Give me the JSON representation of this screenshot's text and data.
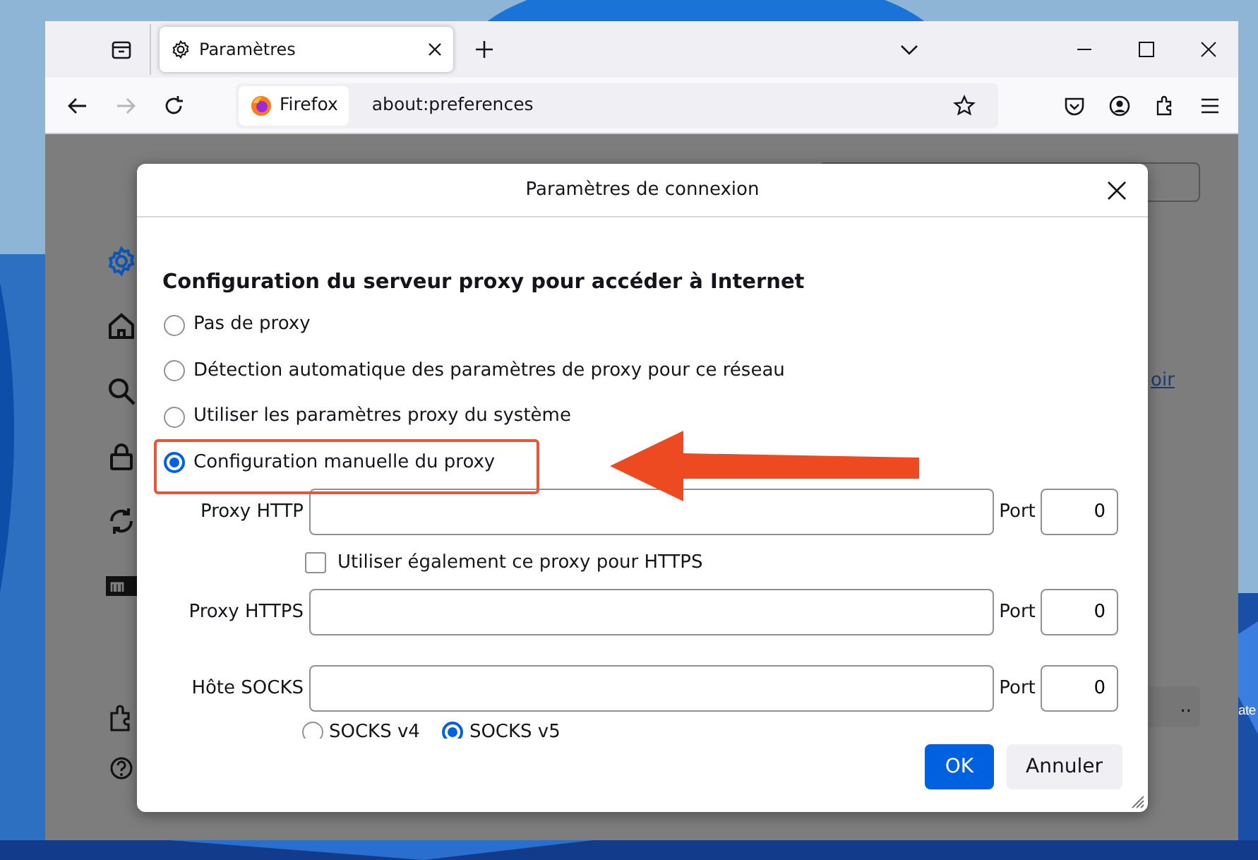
{
  "desktop": {
    "icon_label": "ate"
  },
  "browser": {
    "tabs": [
      {
        "label": "Paramètres",
        "selected": true
      }
    ],
    "address": {
      "identity": "Firefox",
      "url": "about:preferences"
    }
  },
  "page_behind": {
    "sidebar": [
      {
        "kind": "gear",
        "selected": true
      },
      {
        "kind": "home",
        "selected": false
      },
      {
        "kind": "search",
        "selected": false
      },
      {
        "kind": "lock",
        "selected": false
      },
      {
        "kind": "sync",
        "selected": false
      },
      {
        "kind": "logo",
        "selected": false
      }
    ],
    "footer_icons": [
      {
        "kind": "extension"
      },
      {
        "kind": "help"
      }
    ],
    "link": "oir",
    "button": ".."
  },
  "dialog": {
    "title": "Paramètres de connexion",
    "heading": "Configuration du serveur proxy pour accéder à Internet",
    "modes": [
      {
        "label": "Pas de proxy",
        "selected": false
      },
      {
        "label": "Détection automatique des paramètres de proxy pour ce réseau",
        "selected": false
      },
      {
        "label": "Utiliser les paramètres proxy du système",
        "selected": false
      },
      {
        "label": "Configuration manuelle du proxy",
        "selected": true
      }
    ],
    "proxies": [
      {
        "label": "Proxy HTTP",
        "port_label": "Port",
        "port": "0"
      },
      {
        "label": "Proxy HTTPS",
        "port_label": "Port",
        "port": "0"
      },
      {
        "label": "Hôte SOCKS",
        "port_label": "Port",
        "port": "0"
      }
    ],
    "https_checkbox": {
      "label": "Utiliser également ce proxy pour HTTPS",
      "checked": false
    },
    "socks_versions": [
      {
        "label": "SOCKS v4",
        "selected": false
      },
      {
        "label": "SOCKS v5",
        "selected": true
      }
    ],
    "buttons": [
      {
        "label": "OK",
        "kind": "primary"
      },
      {
        "label": "Annuler",
        "kind": "secondary"
      }
    ]
  }
}
